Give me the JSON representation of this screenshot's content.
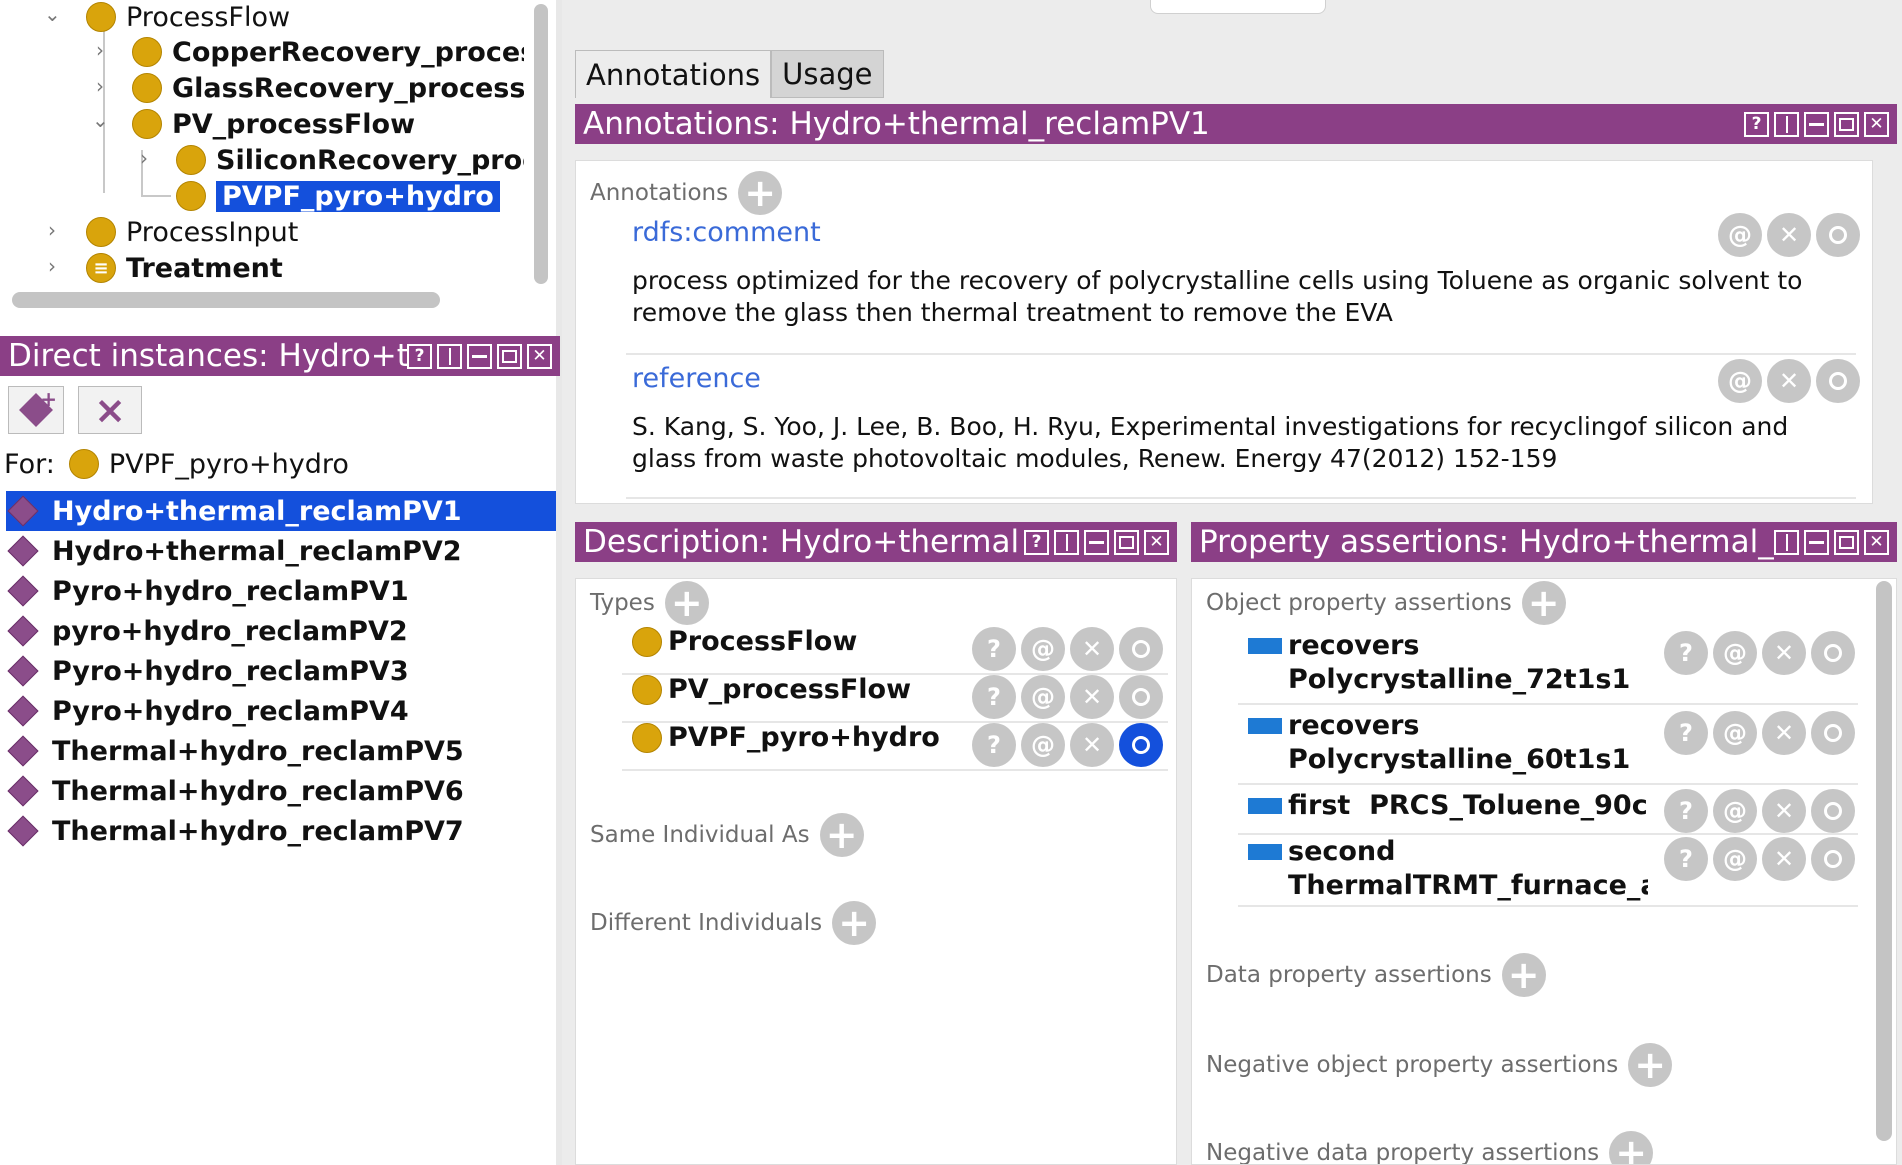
{
  "class_tree": {
    "nodes": [
      {
        "label": "ProcessFlow"
      },
      {
        "label": "CopperRecovery_processFl"
      },
      {
        "label": "GlassRecovery_processFlo"
      },
      {
        "label": "PV_processFlow"
      },
      {
        "label": "SiliconRecovery_proce"
      },
      {
        "label": "PVPF_pyro+hydro"
      },
      {
        "label": "ProcessInput"
      },
      {
        "label": "Treatment"
      }
    ]
  },
  "direct_instances": {
    "title": "Direct instances: Hydro+t",
    "for_label": "For:",
    "for_value": "PVPF_pyro+hydro",
    "items": [
      {
        "label": "Hydro+thermal_reclamPV1"
      },
      {
        "label": "Hydro+thermal_reclamPV2"
      },
      {
        "label": "Pyro+hydro_reclamPV1"
      },
      {
        "label": "pyro+hydro_reclamPV2"
      },
      {
        "label": "Pyro+hydro_reclamPV3"
      },
      {
        "label": "Pyro+hydro_reclamPV4"
      },
      {
        "label": "Thermal+hydro_reclamPV5"
      },
      {
        "label": "Thermal+hydro_reclamPV6"
      },
      {
        "label": "Thermal+hydro_reclamPV7"
      }
    ]
  },
  "tabs": [
    {
      "label": "Annotations"
    },
    {
      "label": "Usage"
    }
  ],
  "annotations": {
    "title": "Annotations: Hydro+thermal_reclamPV1",
    "section_label": "Annotations",
    "items": [
      {
        "property": "rdfs:comment",
        "lines": [
          "process optimized for the recovery of polycrystalline cells using Toluene as organic solvent  to",
          "remove the glass then thermal treatment to remove the EVA"
        ]
      },
      {
        "property": "reference",
        "lines": [
          "S. Kang, S. Yoo, J. Lee, B. Boo, H. Ryu, Experimental investigations for recyclingof silicon and",
          "glass from waste photovoltaic modules, Renew. Energy 47(2012) 152-159"
        ]
      }
    ]
  },
  "description": {
    "title": "Description: Hydro+thermal",
    "types_label": "Types",
    "types": [
      {
        "label": "ProcessFlow"
      },
      {
        "label": "PV_processFlow"
      },
      {
        "label": "PVPF_pyro+hydro"
      }
    ],
    "same_individual_label": "Same Individual As",
    "different_individuals_label": "Different Individuals"
  },
  "property_assertions": {
    "title": "Property assertions: Hydro+thermal_",
    "object_label": "Object property assertions",
    "object_assertions": [
      {
        "line1": "recovers",
        "line2": "Polycrystalline_72t1s1"
      },
      {
        "line1": "recovers",
        "line2": "Polycrystalline_60t1s1"
      },
      {
        "line1": "first  PRCS_Toluene_90c",
        "line2": ""
      },
      {
        "line1": "second",
        "line2": "ThermalTRMT_furnace_argo"
      }
    ],
    "data_label": "Data property assertions",
    "neg_object_label": "Negative object property assertions",
    "neg_data_label": "Negative data property assertions"
  },
  "icons": {
    "help": "?",
    "annotate": "@",
    "delete": "✕",
    "plus": "+"
  }
}
